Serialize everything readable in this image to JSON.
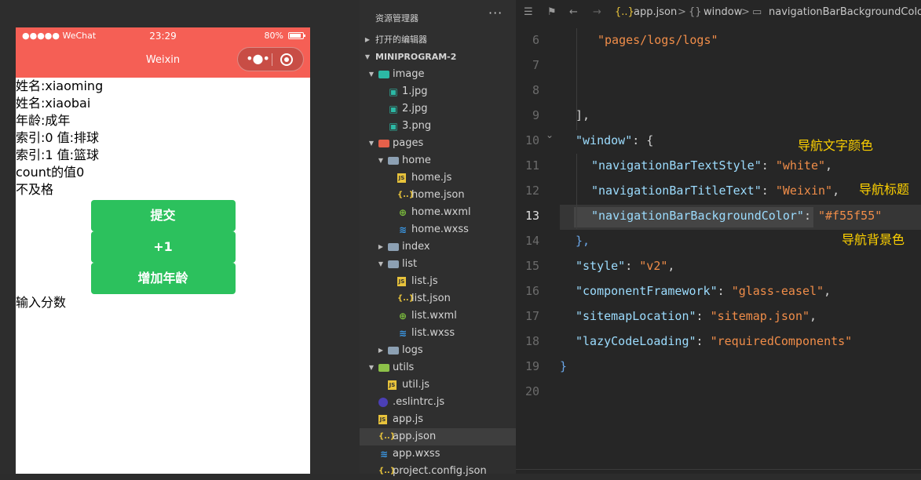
{
  "simulator": {
    "status_left": "●●●●● WeChat",
    "time": "23:29",
    "battery": "80%",
    "nav_title": "Weixin",
    "nav_bg": "#f55f55",
    "capsule_more": "•●•",
    "lines_top": [
      "姓名:xiaoming",
      "姓名:xiaobai",
      "年龄:成年",
      "索引:0 值:排球",
      "索引:1 值:篮球",
      "count的值0",
      "不及格"
    ],
    "buttons": [
      "提交",
      "+1",
      "增加年龄"
    ],
    "input_label": "输入分数",
    "button_color": "#2cc15d"
  },
  "explorer": {
    "header": "资源管理器",
    "more": "···",
    "open_editors": "打开的编辑器",
    "project": "MINIPROGRAM-2",
    "rows": [
      {
        "label": "image",
        "type": "folder-img"
      },
      {
        "label": "1.jpg",
        "type": "img"
      },
      {
        "label": "2.jpg",
        "type": "img"
      },
      {
        "label": "3.png",
        "type": "img"
      },
      {
        "label": "pages",
        "type": "folder-pages"
      },
      {
        "label": "home",
        "type": "folder"
      },
      {
        "label": "home.js",
        "type": "js"
      },
      {
        "label": "home.json",
        "type": "json"
      },
      {
        "label": "home.wxml",
        "type": "wxml"
      },
      {
        "label": "home.wxss",
        "type": "wxss"
      },
      {
        "label": "index",
        "type": "folder"
      },
      {
        "label": "list",
        "type": "folder"
      },
      {
        "label": "list.js",
        "type": "js"
      },
      {
        "label": "list.json",
        "type": "json"
      },
      {
        "label": "list.wxml",
        "type": "wxml"
      },
      {
        "label": "list.wxss",
        "type": "wxss"
      },
      {
        "label": "logs",
        "type": "folder"
      },
      {
        "label": "utils",
        "type": "folder-utils"
      },
      {
        "label": "util.js",
        "type": "js"
      },
      {
        "label": ".eslintrc.js",
        "type": "eslint"
      },
      {
        "label": "app.js",
        "type": "js"
      },
      {
        "label": "app.json",
        "type": "json"
      },
      {
        "label": "app.wxss",
        "type": "wxss"
      },
      {
        "label": "project.config.json",
        "type": "json"
      }
    ]
  },
  "editor": {
    "breadcrumb": {
      "file": "app.json",
      "sep1": ">",
      "obj": "window",
      "sep2": ">",
      "prop": "navigationBarBackgroundColor",
      "file_icon": "{..}",
      "obj_icon": "{}",
      "prop_icon": "▭"
    },
    "line_numbers": [
      "6",
      "7",
      "8",
      "9",
      "10",
      "11",
      "12",
      "13",
      "14",
      "15",
      "16",
      "17",
      "18",
      "19",
      "20"
    ],
    "code": {
      "l6": "\"pages/logs/logs\"",
      "l9": "],",
      "l10_key": "\"window\"",
      "l10_rest": ": {",
      "l11_key": "\"navigationBarTextStyle\"",
      "l11_val": "\"white\"",
      "l12_key": "\"navigationBarTitleText\"",
      "l12_val": "\"Weixin\"",
      "l13_key": "\"navigationBarBackgroundColor\"",
      "l13_val": "\"#f55f55\"",
      "l14": "},",
      "l15_key": "\"style\"",
      "l15_val": "\"v2\"",
      "l16_key": "\"componentFramework\"",
      "l16_val": "\"glass-easel\"",
      "l17_key": "\"sitemapLocation\"",
      "l17_val": "\"sitemap.json\"",
      "l18_key": "\"lazyCodeLoading\"",
      "l18_val": "\"requiredComponents\"",
      "l19": "}",
      "colon": ": ",
      "comma": ","
    },
    "annotations": {
      "text_color": "导航文字颜色",
      "title": "导航标题",
      "bg_color": "导航背景色"
    },
    "annotation_color": "#ffd200"
  }
}
